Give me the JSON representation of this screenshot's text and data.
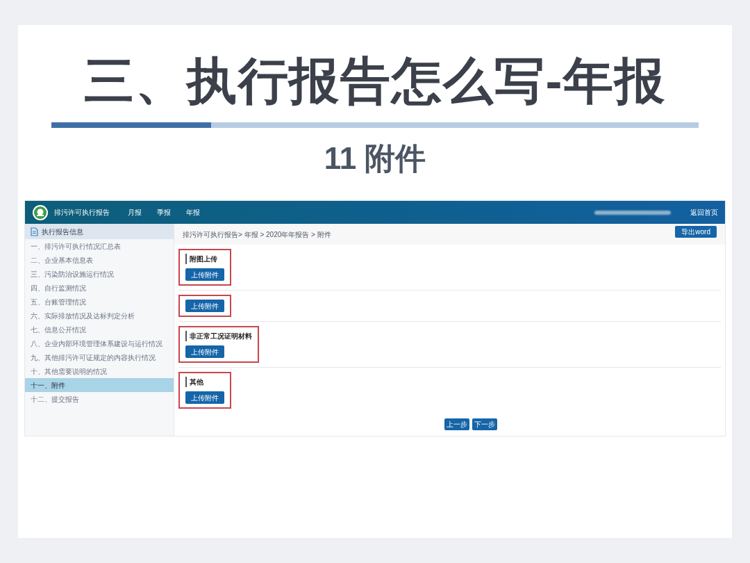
{
  "slide": {
    "title": "三、执行报告怎么写-年报",
    "subtitle": "11 附件"
  },
  "app": {
    "header": {
      "title": "排污许可执行报告",
      "nav": [
        "月报",
        "季报",
        "年报"
      ],
      "home_link": "返回首页"
    },
    "sidebar": {
      "heading": "执行报告信息",
      "items": [
        {
          "label": "一、排污许可执行情况汇总表",
          "selected": false
        },
        {
          "label": "二、企业基本信息表",
          "selected": false
        },
        {
          "label": "三、污染防治设施运行情况",
          "selected": false
        },
        {
          "label": "四、自行监测情况",
          "selected": false
        },
        {
          "label": "五、台账管理情况",
          "selected": false
        },
        {
          "label": "六、实际排放情况及达标判定分析",
          "selected": false
        },
        {
          "label": "七、信息公开情况",
          "selected": false
        },
        {
          "label": "八、企业内部环境管理体系建设与运行情况",
          "selected": false
        },
        {
          "label": "九、其他排污许可证规定的内容执行情况",
          "selected": false
        },
        {
          "label": "十、其他需要说明的情况",
          "selected": false
        },
        {
          "label": "十一、附件",
          "selected": true
        },
        {
          "label": "十二、提交报告",
          "selected": false
        }
      ]
    },
    "breadcrumb": "排污许可执行报告> 年报 > 2020年年报告 > 附件",
    "export_button": "导出word",
    "sections": [
      {
        "title": "附图上传",
        "button": "上传附件"
      },
      {
        "button": "上传附件"
      },
      {
        "title": "非正常工况证明材料",
        "button": "上传附件"
      },
      {
        "title": "其他",
        "button": "上传附件"
      }
    ],
    "prev_button": "上一步",
    "next_button": "下一步"
  }
}
